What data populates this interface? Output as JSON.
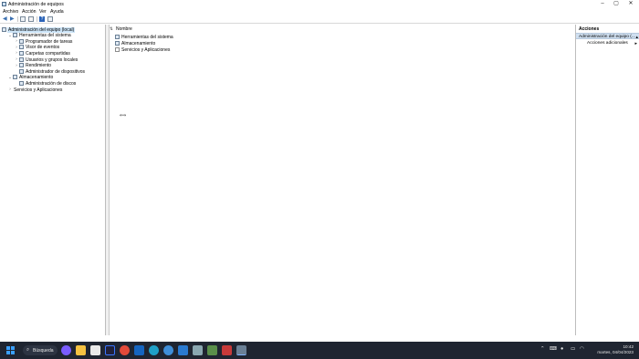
{
  "window": {
    "title": "Administración de equipos",
    "controls": [
      "minimize-icon",
      "maximize-icon",
      "close-icon"
    ]
  },
  "menu": [
    "Archivo",
    "Acción",
    "Ver",
    "Ayuda"
  ],
  "tree": [
    {
      "label": "Administración del equipo (local)",
      "level": 0,
      "selected": true,
      "expander": ""
    },
    {
      "label": "Herramientas del sistema",
      "level": 1,
      "expander": "⌄"
    },
    {
      "label": "Programador de tareas",
      "level": 2,
      "expander": "›"
    },
    {
      "label": "Visor de eventos",
      "level": 2,
      "expander": "›"
    },
    {
      "label": "Carpetas compartidas",
      "level": 2,
      "expander": "›"
    },
    {
      "label": "Usuarios y grupos locales",
      "level": 2,
      "expander": "›"
    },
    {
      "label": "Rendimiento",
      "level": 2,
      "expander": "›"
    },
    {
      "label": "Administrador de dispositivos",
      "level": 2,
      "expander": ""
    },
    {
      "label": "Almacenamiento",
      "level": 1,
      "expander": "⌄"
    },
    {
      "label": "Administración de discos",
      "level": 2,
      "expander": ""
    },
    {
      "label": "Servicios y Aplicaciones",
      "level": 1,
      "expander": "›",
      "noicon": true
    }
  ],
  "list": {
    "column": "Nombre",
    "items": [
      "Herramientas del sistema",
      "Almacenamiento",
      "Servicios y Aplicaciones"
    ]
  },
  "actions": {
    "title": "Acciones",
    "section": "Administración del equipo (...",
    "items": [
      "Acciones adicionales"
    ]
  },
  "taskbar": {
    "search_label": "Búsqueda",
    "time": "10:42",
    "date": "martes, 04/04/2023"
  },
  "colors": {
    "selection": "#cce4f7",
    "actions_header": "#cfdff0",
    "taskbar": "#1f2531",
    "windows_logo": "#3aa0ff"
  }
}
